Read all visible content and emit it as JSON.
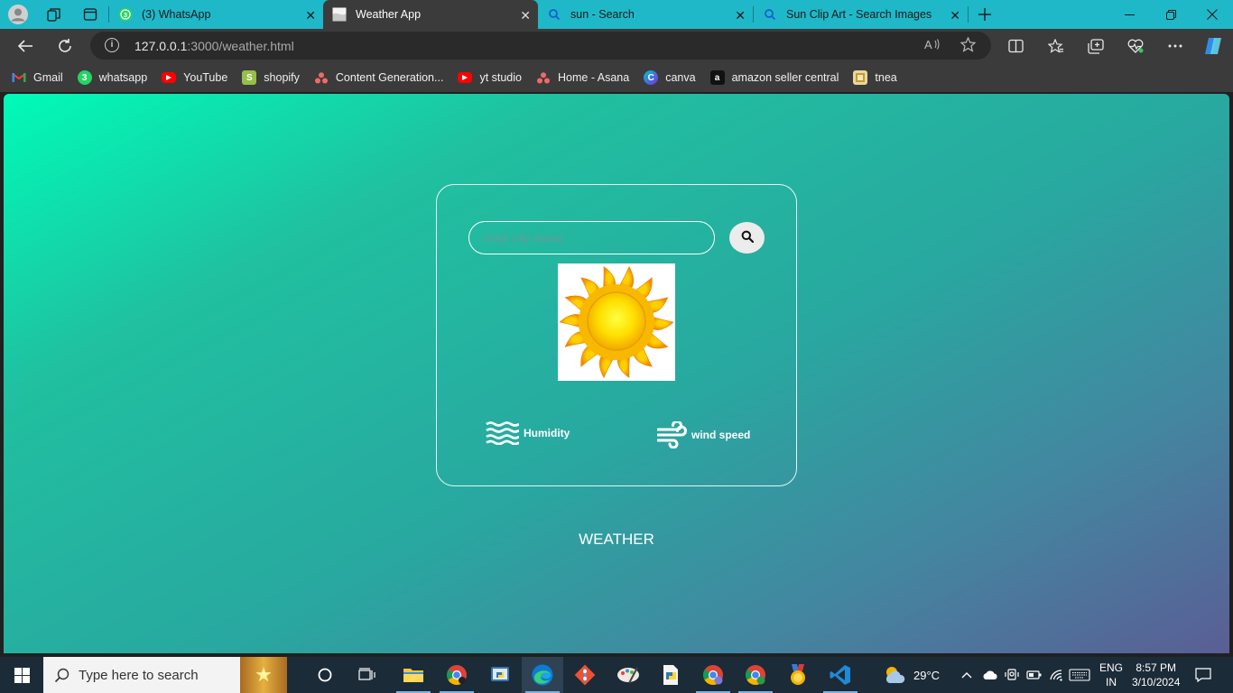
{
  "browser": {
    "tabs": [
      {
        "label": "(3) WhatsApp",
        "badge": "3",
        "active": false
      },
      {
        "label": "Weather App",
        "active": true
      },
      {
        "label": "sun - Search",
        "active": false
      },
      {
        "label": "Sun Clip Art - Search Images",
        "active": false
      }
    ],
    "url_host": "127.0.0.1",
    "url_path": ":3000/weather.html",
    "bookmarks": [
      {
        "label": "Gmail",
        "icon": "gmail-icon"
      },
      {
        "label": "whatsapp",
        "icon": "whatsapp-icon"
      },
      {
        "label": "YouTube",
        "icon": "youtube-icon"
      },
      {
        "label": "shopify",
        "icon": "shopify-icon"
      },
      {
        "label": "Content Generation...",
        "icon": "asana-icon"
      },
      {
        "label": "yt studio",
        "icon": "youtube-icon"
      },
      {
        "label": "Home - Asana",
        "icon": "asana-icon"
      },
      {
        "label": "canva",
        "icon": "canva-icon"
      },
      {
        "label": "amazon seller central",
        "icon": "amazon-icon"
      },
      {
        "label": "tnea",
        "icon": "tnea-icon"
      }
    ]
  },
  "app": {
    "search_placeholder": "enter city name",
    "weather_icon": "sun",
    "humidity_label": "Humidity",
    "wind_label": "wind speed",
    "heading": "WEATHER"
  },
  "taskbar": {
    "search_placeholder": "Type here to search",
    "weather_temp": "29°C",
    "language": "ENG",
    "region": "IN",
    "time": "8:57 PM",
    "date": "3/10/2024"
  },
  "colors": {
    "tab_strip": "#1fb8c8",
    "gradient_start": "#00fbb8",
    "gradient_end": "#5a5e95"
  }
}
